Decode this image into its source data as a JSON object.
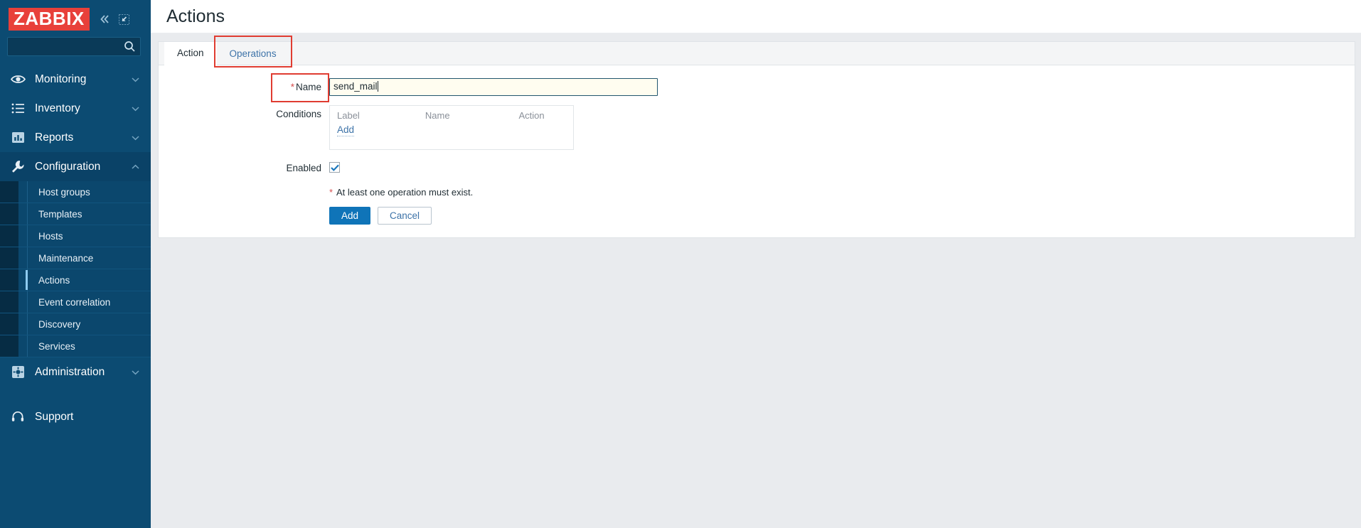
{
  "brand": {
    "logo_text": "ZABBIX"
  },
  "topbar": {
    "collapse_icon": "chevron-double-left-icon",
    "compact_icon": "compact-view-icon"
  },
  "search": {
    "value": "",
    "placeholder": "",
    "icon": "search-icon"
  },
  "sidebar": {
    "items": [
      {
        "label": "Monitoring",
        "icon": "eye-icon",
        "chevron": "chevron-down-icon",
        "expanded": false
      },
      {
        "label": "Inventory",
        "icon": "list-icon",
        "chevron": "chevron-down-icon",
        "expanded": false
      },
      {
        "label": "Reports",
        "icon": "bar-chart-icon",
        "chevron": "chevron-down-icon",
        "expanded": false
      },
      {
        "label": "Configuration",
        "icon": "wrench-icon",
        "chevron": "chevron-up-icon",
        "expanded": true
      }
    ],
    "configuration_submenu": [
      {
        "label": "Host groups",
        "active": false
      },
      {
        "label": "Templates",
        "active": false
      },
      {
        "label": "Hosts",
        "active": false
      },
      {
        "label": "Maintenance",
        "active": false
      },
      {
        "label": "Actions",
        "active": true
      },
      {
        "label": "Event correlation",
        "active": false
      },
      {
        "label": "Discovery",
        "active": false
      },
      {
        "label": "Services",
        "active": false
      }
    ],
    "administration": {
      "label": "Administration",
      "icon": "gear-square-icon",
      "chevron": "chevron-down-icon"
    },
    "support": {
      "label": "Support",
      "icon": "headset-icon"
    }
  },
  "header": {
    "title": "Actions"
  },
  "tabs": [
    {
      "label": "Action",
      "active": true,
      "annotated": false
    },
    {
      "label": "Operations",
      "active": false,
      "annotated": true
    }
  ],
  "form": {
    "name": {
      "label": "Name",
      "required_marker": "*",
      "value": "send_mail",
      "placeholder": "",
      "annotated": true
    },
    "conditions": {
      "label": "Conditions",
      "columns": [
        "Label",
        "Name",
        "Action"
      ],
      "rows": [],
      "add_link": "Add"
    },
    "enabled": {
      "label": "Enabled",
      "checked": true
    },
    "validation_hint": {
      "marker": "*",
      "text": "At least one operation must exist."
    },
    "buttons": [
      {
        "label": "Add",
        "style": "primary"
      },
      {
        "label": "Cancel",
        "style": "secondary"
      }
    ]
  },
  "colors": {
    "sidebar_bg": "#0c4b72",
    "logo_red": "#e8403a",
    "accent_blue": "#0f74b8",
    "link_blue": "#3d73a8",
    "annotation_red": "#e03c31",
    "required_red": "#d64e4e",
    "active_rail": "#8ecbf0"
  }
}
